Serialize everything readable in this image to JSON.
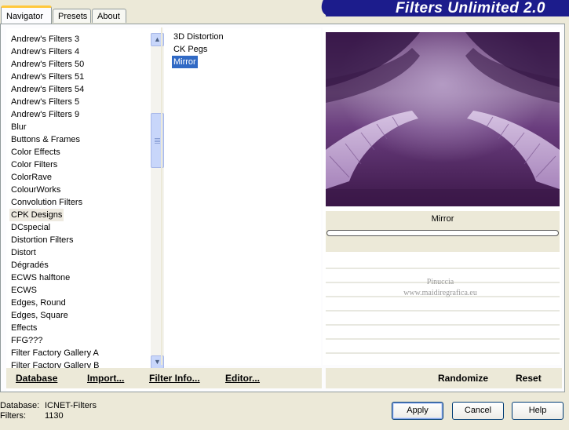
{
  "app": {
    "title": "Filters Unlimited 2.0"
  },
  "tabs": [
    {
      "label": "Navigator",
      "active": true
    },
    {
      "label": "Presets",
      "active": false
    },
    {
      "label": "About",
      "active": false
    }
  ],
  "categories": {
    "items": [
      "Andrew's Filters 3",
      "Andrew's Filters 4",
      "Andrew's Filters 50",
      "Andrew's Filters 51",
      "Andrew's Filters 54",
      "Andrew's Filters 5",
      "Andrew's Filters 9",
      "Blur",
      "Buttons & Frames",
      "Color Effects",
      "Color Filters",
      "ColorRave",
      "ColourWorks",
      "Convolution Filters",
      "CPK Designs",
      "DCspecial",
      "Distortion Filters",
      "Distort",
      "Dégradés",
      "ECWS halftone",
      "ECWS",
      "Edges, Round",
      "Edges, Square",
      "Effects",
      "FFG???",
      "Filter Factory Gallery A",
      "Filter Factory Gallery B"
    ],
    "selected": "CPK Designs"
  },
  "filters": {
    "items": [
      "3D Distortion",
      "CK Pegs",
      "Mirror"
    ],
    "selected": "Mirror"
  },
  "preview": {
    "filter_name": "Mirror",
    "progress": 0,
    "watermark_line1": "Pinuccia",
    "watermark_line2": "www.maidiregrafica.eu",
    "colors": {
      "dark": "#3b1748",
      "mid": "#6a3d7e",
      "light": "#b9a1c9"
    }
  },
  "toolbar": {
    "database_label": "Database",
    "import_label": "Import...",
    "filter_info_label": "Filter Info...",
    "editor_label": "Editor...",
    "randomize_label": "Randomize",
    "reset_label": "Reset"
  },
  "status": {
    "database_label": "Database:",
    "database_value": "ICNET-Filters",
    "filters_label": "Filters:",
    "filters_value": "1130"
  },
  "dialog": {
    "apply_label": "Apply",
    "cancel_label": "Cancel",
    "help_label": "Help"
  },
  "colors": {
    "accent": "#316ac5",
    "title_band": "#1c1c8c",
    "tab_highlight": "#ffc83c"
  }
}
